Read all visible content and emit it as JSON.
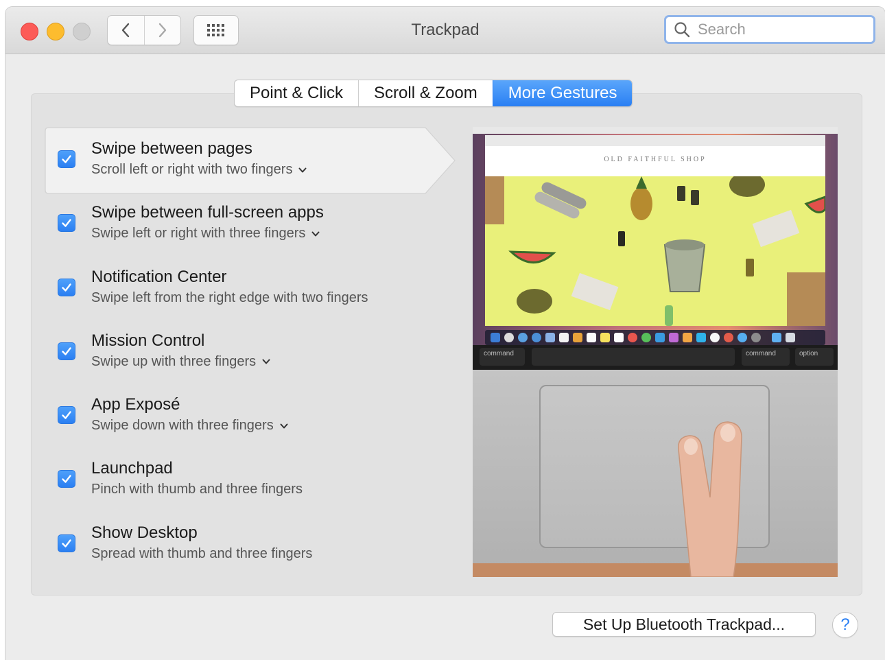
{
  "window": {
    "title": "Trackpad"
  },
  "toolbar": {
    "back_icon": "chevron-left-icon",
    "forward_icon": "chevron-right-icon",
    "show_all_icon": "grid-icon"
  },
  "search": {
    "placeholder": "Search",
    "value": ""
  },
  "tabs": [
    {
      "label": "Point & Click",
      "active": false
    },
    {
      "label": "Scroll & Zoom",
      "active": false
    },
    {
      "label": "More Gestures",
      "active": true
    }
  ],
  "gestures": [
    {
      "title": "Swipe between pages",
      "subtitle": "Scroll left or right with two fingers",
      "checked": true,
      "has_dropdown": true,
      "selected": true
    },
    {
      "title": "Swipe between full-screen apps",
      "subtitle": "Swipe left or right with three fingers",
      "checked": true,
      "has_dropdown": true
    },
    {
      "title": "Notification Center",
      "subtitle": "Swipe left from the right edge with two fingers",
      "checked": true,
      "has_dropdown": false
    },
    {
      "title": "Mission Control",
      "subtitle": "Swipe up with three fingers",
      "checked": true,
      "has_dropdown": true
    },
    {
      "title": "App Exposé",
      "subtitle": "Swipe down with three fingers",
      "checked": true,
      "has_dropdown": true
    },
    {
      "title": "Launchpad",
      "subtitle": "Pinch with thumb and three fingers",
      "checked": true,
      "has_dropdown": false
    },
    {
      "title": "Show Desktop",
      "subtitle": "Spread with thumb and three fingers",
      "checked": true,
      "has_dropdown": false
    }
  ],
  "preview": {
    "shop_name": "OLD FAITHFUL SHOP",
    "keys": [
      "command",
      "command",
      "option"
    ]
  },
  "footer": {
    "bluetooth_button": "Set Up Bluetooth Trackpad...",
    "help_button": "?"
  },
  "colors": {
    "accent": "#2a7ff3",
    "close": "#fc5b57",
    "minimize": "#fdbc2e",
    "zoom_disabled": "#cfcfcf"
  }
}
